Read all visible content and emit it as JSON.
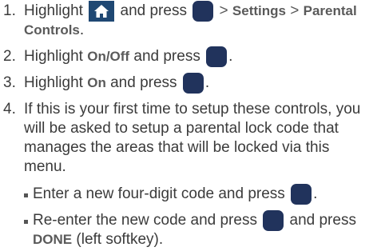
{
  "steps": [
    {
      "number": "1.",
      "text_a": "Highlight",
      "text_b": "and press",
      "menu_settings": "Settings",
      "menu_parental": "Parental",
      "menu_parental_cont": "Controls",
      "period": "."
    },
    {
      "number": "2.",
      "text_a": "Highlight",
      "target": "On/Off",
      "text_b": "and press",
      "period": "."
    },
    {
      "number": "3.",
      "text_a": "Highlight",
      "target": "On",
      "text_b": "and press",
      "period": "."
    },
    {
      "number": "4.",
      "lines": [
        "If this is your first time to setup these controls, you",
        "will be asked to setup a parental lock code that",
        "manages the areas that will be locked via this",
        "menu."
      ]
    }
  ],
  "bullets": [
    {
      "text_a": "Enter a new four-digit code and press",
      "period": "."
    },
    {
      "text_a": "Re-enter the new code and press",
      "text_b": "and press",
      "done": "DONE",
      "done_suffix": "(left softkey)."
    }
  ],
  "separator": ">",
  "icons": {
    "home": "home-icon",
    "select_key": "select-key-icon"
  },
  "colors": {
    "text": "#3b3b3b",
    "key": "#21335c",
    "home_key": "#1f4873"
  }
}
